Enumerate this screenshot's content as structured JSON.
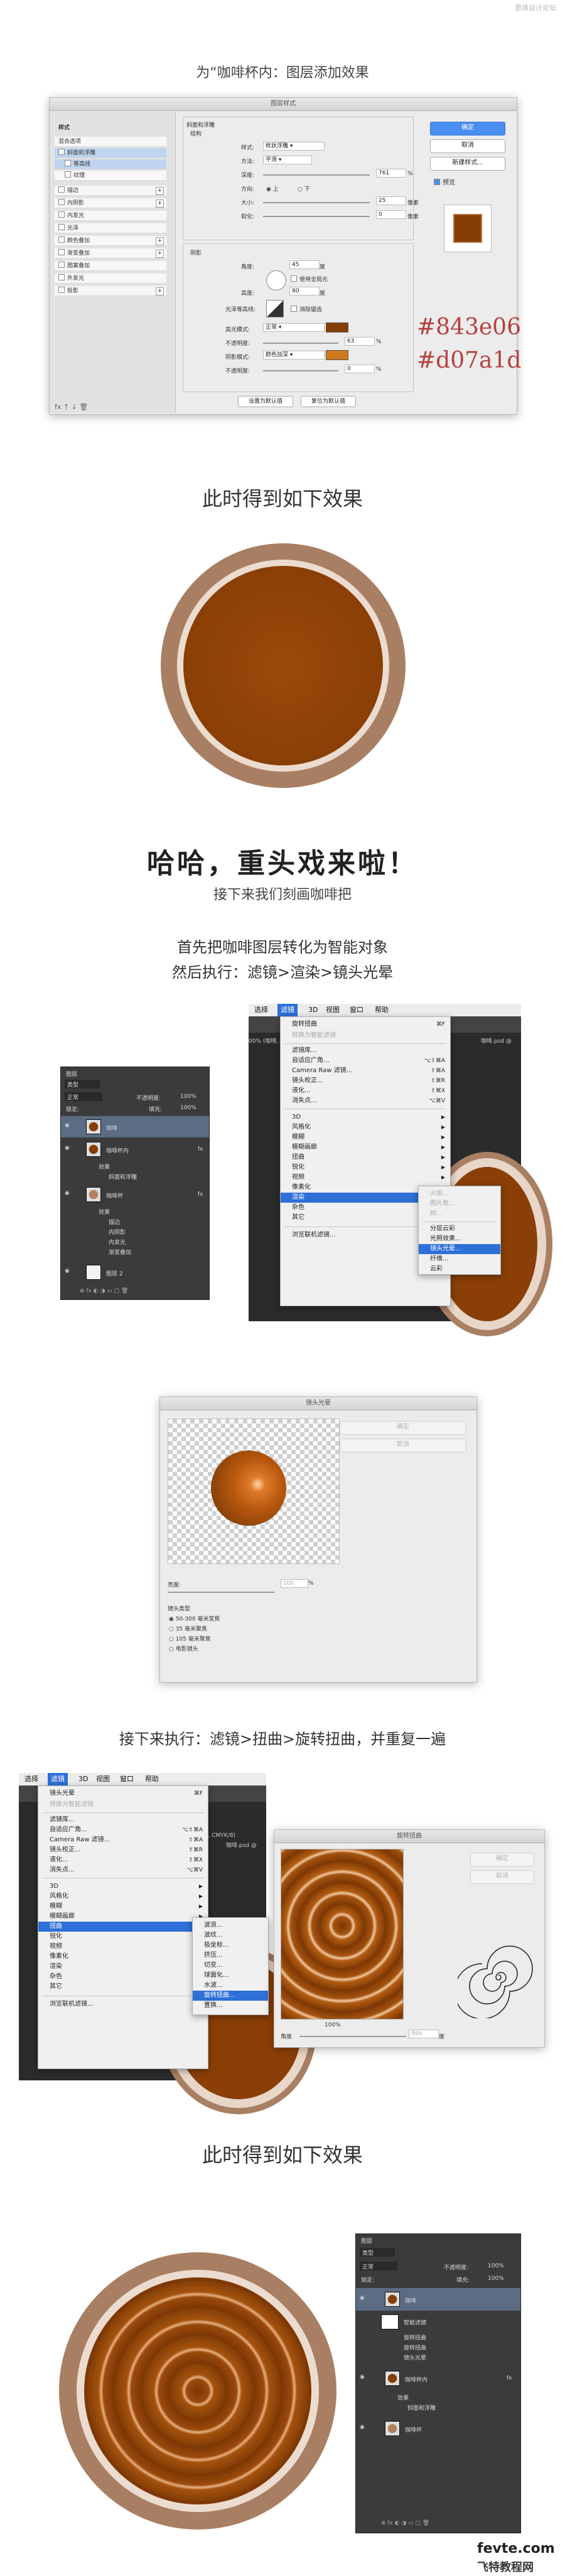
{
  "watermark": "思缘设计论坛",
  "sections": {
    "s1_title": "为“咖啡杯内：图层添加效果",
    "s2_title": "此时得到如下效果",
    "s3_big": "哈哈，重头戏来啦！",
    "s3_sub": "接下来我们刻画咖啡把",
    "s4_line1": "首先把咖啡图层转化为智能对象",
    "s4_line2": "然后执行：滤镜>渲染>镜头光晕",
    "s5_title": "接下来执行：滤镜>扭曲>旋转扭曲，并重复一遍",
    "s6_title": "此时得到如下效果"
  },
  "layer_style_dialog": {
    "title": "图层样式",
    "left_list": [
      "样式",
      "混合选项",
      "斜面和浮雕",
      "等高线",
      "纹理",
      "描边",
      "内阴影",
      "内发光",
      "光泽",
      "颜色叠加",
      "渐变叠加",
      "图案叠加",
      "外发光",
      "投影"
    ],
    "buttons": [
      "确定",
      "取消",
      "新建样式...",
      "预览"
    ],
    "bevel": {
      "header": "斜面和浮雕",
      "struct": "结构",
      "style_label": "样式:",
      "style_val": "枕状浮雕",
      "method_label": "方法:",
      "method_val": "平滑",
      "depth_label": "深度:",
      "depth_val": "761",
      "pct": "%",
      "dir_label": "方向:",
      "dir_up": "上",
      "dir_down": "下",
      "size_label": "大小:",
      "size_val": "25",
      "px": "像素",
      "soften_label": "软化:",
      "soften_val": "0",
      "shading": "阴影",
      "angle_label": "角度:",
      "angle_val": "45",
      "deg": "度",
      "global": "使用全局光",
      "alt_label": "高度:",
      "alt_val": "80",
      "gloss_label": "光泽等高线:",
      "anti": "消除锯齿",
      "hl_label": "高光模式:",
      "hl_mode": "正常",
      "op1_label": "不透明度:",
      "op1_val": "63",
      "sh_label": "阴影模式:",
      "sh_mode": "颜色加深",
      "op2_label": "不透明度:",
      "op2_val": "0",
      "default_btn": "设置为默认值",
      "reset_btn": "复位为默认值"
    },
    "hex1": "#843e06",
    "hex2": "#d07a1d"
  },
  "colors": {
    "coffee_dark": "#843e06",
    "coffee_light": "#d07a1d",
    "cup_rim": "#a97f63",
    "cup_inner_rim": "#e8d6c8"
  },
  "layers_panel_1": {
    "title": "图层",
    "kind": "类型",
    "blend": "正常",
    "opacity_label": "不透明度:",
    "opacity": "100%",
    "lock": "锁定:",
    "fill_label": "填充:",
    "fill": "100%",
    "rows": [
      "咖啡",
      "咖啡杯内",
      "效果",
      "斜面和浮雕",
      "咖啡杯",
      "效果",
      "描边",
      "内阴影",
      "内发光",
      "渐变叠加",
      "图层 2"
    ]
  },
  "menu1": {
    "bar": [
      "选择",
      "滤镜",
      "3D",
      "视图",
      "窗口",
      "帮助"
    ],
    "items": [
      "旋转扭曲",
      "转换为智能滤镜",
      "滤镜库...",
      "自适应广角...",
      "Camera Raw 滤镜...",
      "镜头校正...",
      "液化...",
      "消失点...",
      "3D",
      "风格化",
      "模糊",
      "模糊画廊",
      "扭曲",
      "锐化",
      "视频",
      "像素化",
      "渲染",
      "杂色",
      "其它",
      "浏览联机滤镜..."
    ],
    "shortcuts": [
      "⌘F",
      "⌥⇧⌘A",
      "⇧⌘A",
      "⇧⌘R",
      "⇧⌘X",
      "⌥⌘V"
    ],
    "submenu": [
      "火焰...",
      "图片框...",
      "树...",
      "分层云彩",
      "光照效果...",
      "镜头光晕...",
      "纤维...",
      "云彩"
    ],
    "tab": "咖啡.psd @",
    "doc": "00% (咖啡, CMYK/8)"
  },
  "lens_flare": {
    "title": "镜头光晕",
    "ok": "确定",
    "cancel": "取消",
    "brightness_label": "亮度:",
    "brightness": "100",
    "pct": "%",
    "type_label": "镜头类型",
    "types": [
      "50-300 毫米变焦",
      "35 毫米聚焦",
      "105 毫米聚焦",
      "电影镜头"
    ]
  },
  "menu2": {
    "bar": [
      "选择",
      "滤镜",
      "3D",
      "视图",
      "窗口",
      "帮助"
    ],
    "items": [
      "镜头光晕",
      "转换为智能滤镜",
      "滤镜库...",
      "自适应广角...",
      "Camera Raw 滤镜...",
      "镜头校正...",
      "液化...",
      "消失点...",
      "3D",
      "风格化",
      "模糊",
      "模糊画廊",
      "扭曲",
      "锐化",
      "视频",
      "像素化",
      "渲染",
      "杂色",
      "其它",
      "浏览联机滤镜..."
    ],
    "shortcuts": [
      "⌘F",
      "⌥⇧⌘A",
      "⇧⌘A",
      "⇧⌘R",
      "⇧⌘X",
      "⌥⌘V"
    ],
    "submenu": [
      "波浪...",
      "波纹...",
      "极坐标...",
      "挤压...",
      "切变...",
      "球面化...",
      "水波...",
      "旋转扭曲...",
      "置换..."
    ],
    "doc": "(咖啡, CMYK/8)",
    "tab": "咖啡.psd @"
  },
  "twirl": {
    "title": "旋转扭曲",
    "ok": "确定",
    "cancel": "取消",
    "zoom": "100%",
    "angle_label": "角度",
    "angle_val": "999",
    "deg": "度"
  },
  "layers_panel_2": {
    "title": "图层",
    "kind": "类型",
    "blend": "正常",
    "opacity_label": "不透明度:",
    "opacity": "100%",
    "lock": "锁定:",
    "fill_label": "填充:",
    "fill": "100%",
    "rows": [
      "咖啡",
      "智能滤镜",
      "旋转扭曲",
      "旋转扭曲",
      "镜头光晕",
      "咖啡杯内",
      "效果",
      "斜面和浮雕",
      "咖啡杯"
    ]
  },
  "footer": {
    "brand": "fevte.com",
    "brand_cn": "飞特教程网"
  }
}
